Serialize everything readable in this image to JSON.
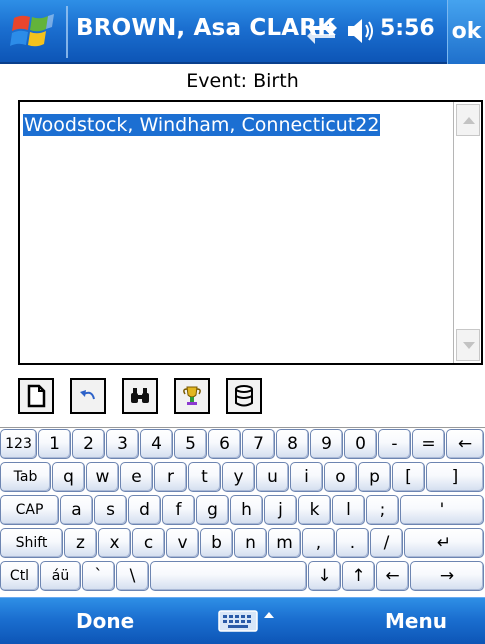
{
  "titlebar": {
    "title": "BROWN, Asa CLARK",
    "time": "5:56",
    "ok_label": "ok",
    "icons": [
      "windows-start-icon",
      "connectivity-icon",
      "volume-icon"
    ]
  },
  "event_label": "Event: Birth",
  "text_field": {
    "value": "Woodstock, Windham, Connecticut22",
    "selected": true
  },
  "toolbar": {
    "buttons": [
      "new-document-icon",
      "undo-icon",
      "find-icon",
      "trophy-icon",
      "database-icon"
    ]
  },
  "keyboard": {
    "row1": [
      "123",
      "1",
      "2",
      "3",
      "4",
      "5",
      "6",
      "7",
      "8",
      "9",
      "0",
      "-",
      "=",
      "←"
    ],
    "row2": [
      "Tab",
      "q",
      "w",
      "e",
      "r",
      "t",
      "y",
      "u",
      "i",
      "o",
      "p",
      "[",
      "]"
    ],
    "row3": [
      "CAP",
      "a",
      "s",
      "d",
      "f",
      "g",
      "h",
      "j",
      "k",
      "l",
      ";",
      "'"
    ],
    "row4": [
      "Shift",
      "z",
      "x",
      "c",
      "v",
      "b",
      "n",
      "m",
      ",",
      ".",
      "/",
      "↵"
    ],
    "row5": [
      "Ctl",
      "áü",
      "`",
      "\\",
      "",
      "↓",
      "↑",
      "←",
      "→"
    ]
  },
  "bottombar": {
    "left_label": "Done",
    "right_label": "Menu"
  },
  "colors": {
    "titlebar": "#1b6fd0",
    "selection": "#1c6fd2",
    "key_border": "#6d85b1"
  }
}
